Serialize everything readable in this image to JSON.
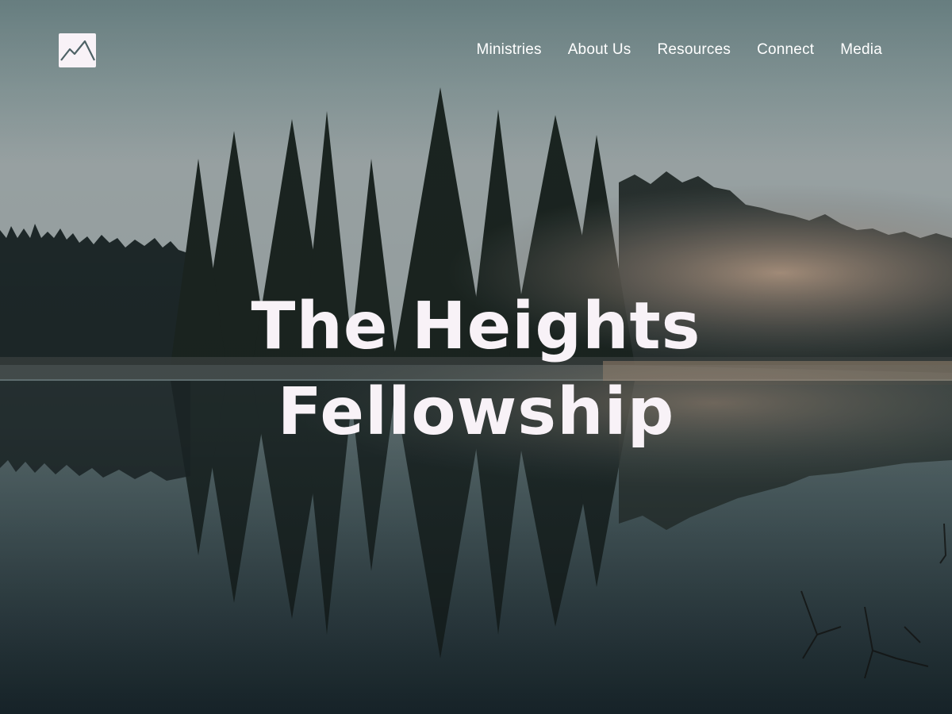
{
  "header": {
    "logo_icon": "mountain-icon"
  },
  "nav": {
    "items": [
      {
        "label": "Ministries"
      },
      {
        "label": "About Us"
      },
      {
        "label": "Resources"
      },
      {
        "label": "Connect"
      },
      {
        "label": "Media"
      }
    ]
  },
  "hero": {
    "title_line1": "The Heights",
    "title_line2": "Fellowship"
  },
  "colors": {
    "title": "#f8f2f7",
    "nav_text": "#ffffff",
    "logo_bg": "#f8f2f7",
    "logo_mark": "#4e6266"
  }
}
